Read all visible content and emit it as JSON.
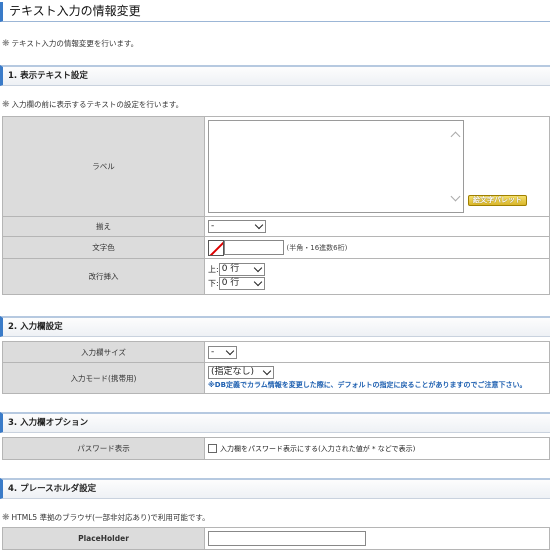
{
  "page": {
    "title": "テキスト入力の情報変更",
    "description": "テキスト入力の情報変更を行います。"
  },
  "section1": {
    "heading": "1. 表示テキスト設定",
    "note": "入力欄の前に表示するテキストの設定を行います。",
    "label_row": {
      "label": "ラベル",
      "value": "",
      "palette_button": "絵文字パレット"
    },
    "align_row": {
      "label": "揃え",
      "value": "-"
    },
    "color_row": {
      "label": "文字色",
      "value": "",
      "hint": "(半角・16進数6桁)"
    },
    "linebreak_row": {
      "label": "改行挿入",
      "top_label": "上:",
      "top_value": "0 行",
      "bottom_label": "下:",
      "bottom_value": "0 行"
    }
  },
  "section2": {
    "heading": "2. 入力欄設定",
    "size_row": {
      "label": "入力欄サイズ",
      "value": "-"
    },
    "mode_row": {
      "label": "入力モード(携帯用)",
      "value": "(指定なし)",
      "warning": "※DB定義でカラム情報を変更した際に、デフォルトの指定に戻ることがありますのでご注意下さい。"
    }
  },
  "section3": {
    "heading": "3. 入力欄オプション",
    "password_row": {
      "label": "パスワード表示",
      "checkbox_label": "入力欄をパスワード表示にする(入力された値が * などで表示)",
      "checked": false
    }
  },
  "section4": {
    "heading": "4. プレースホルダ設定",
    "note": "HTML5 準拠のブラウザ(一部非対応あり)で利用可能です。",
    "placeholder_row": {
      "label": "PlaceHolder",
      "value": ""
    }
  },
  "icons": {
    "note_mark": "asterisk-note-icon",
    "dropdown": "chevron-down-icon",
    "color_swatch": "no-color-swatch-icon"
  },
  "colors": {
    "accent": "#3a7bc8",
    "label_cell_bg": "#dcdcdc",
    "warning_text": "#1d5fb0",
    "palette_button": "#d9b62a"
  }
}
